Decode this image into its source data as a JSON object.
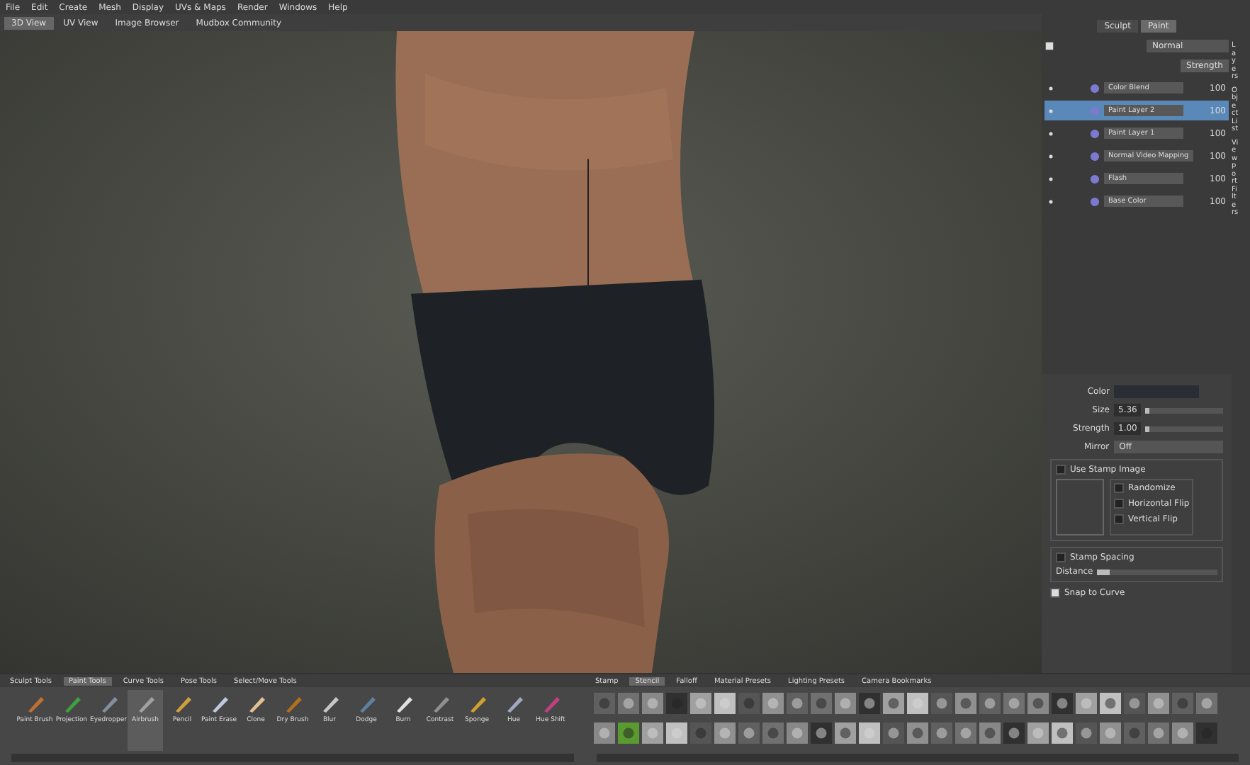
{
  "menu": [
    "File",
    "Edit",
    "Create",
    "Mesh",
    "Display",
    "UVs & Maps",
    "Render",
    "Windows",
    "Help"
  ],
  "view_tabs": [
    {
      "label": "3D View",
      "selected": true
    },
    {
      "label": "UV View",
      "selected": false
    },
    {
      "label": "Image Browser",
      "selected": false
    },
    {
      "label": "Mudbox Community",
      "selected": false
    }
  ],
  "panel": {
    "tabs": [
      {
        "label": "Sculpt",
        "selected": false
      },
      {
        "label": "Paint",
        "selected": true
      }
    ],
    "blend_mode": "Normal",
    "strength_button": "Strength",
    "layers": [
      {
        "name": "Color Blend",
        "value": "100",
        "selected": false
      },
      {
        "name": "Paint Layer 2",
        "value": "100",
        "selected": true
      },
      {
        "name": "Paint Layer 1",
        "value": "100",
        "selected": false
      },
      {
        "name": "Normal Video Mapping",
        "value": "100",
        "selected": false
      },
      {
        "name": "Flash",
        "value": "100",
        "selected": false
      },
      {
        "name": "Base Color",
        "value": "100",
        "selected": false
      }
    ],
    "side_tabs": [
      "Layers",
      "Object List",
      "Viewport Filters"
    ]
  },
  "properties": {
    "color_label": "Color",
    "size_label": "Size",
    "size": "5.36",
    "strength_label": "Strength",
    "strength": "1.00",
    "size_slider": {
      "level": 0.05
    },
    "strength_slider": {
      "level": 0.05
    },
    "distance_slider": {
      "level": 0.1
    },
    "mirror_label": "Mirror",
    "mirror": "Off",
    "use_stamp": {
      "label": "Use Stamp Image",
      "checked": false
    },
    "randomize": {
      "label": "Randomize",
      "checked": false
    },
    "horizontal_flip": {
      "label": "Horizontal Flip",
      "checked": false
    },
    "vertical_flip": {
      "label": "Vertical Flip",
      "checked": false
    },
    "stamp_spacing": {
      "label": "Stamp Spacing",
      "checked": false
    },
    "distance_label": "Distance",
    "snap_to_curve": {
      "label": "Snap to Curve",
      "checked": true
    }
  },
  "tool_tabs": [
    {
      "label": "Sculpt Tools",
      "selected": false
    },
    {
      "label": "Paint Tools",
      "selected": true
    },
    {
      "label": "Curve Tools",
      "selected": false
    },
    {
      "label": "Pose Tools",
      "selected": false
    },
    {
      "label": "Select/Move Tools",
      "selected": false
    }
  ],
  "tools": [
    {
      "label": "Paint Brush",
      "selected": false,
      "color": "#c07030"
    },
    {
      "label": "Projection",
      "selected": false,
      "color": "#40a040"
    },
    {
      "label": "Eyedropper",
      "selected": false,
      "color": "#8090a0"
    },
    {
      "label": "Airbrush",
      "selected": true,
      "color": "#a0a0a0"
    },
    {
      "label": "Pencil",
      "selected": false,
      "color": "#d0a040"
    },
    {
      "label": "Paint Erase",
      "selected": false,
      "color": "#c0c8e0"
    },
    {
      "label": "Clone",
      "selected": false,
      "color": "#e0c090"
    },
    {
      "label": "Dry Brush",
      "selected": false,
      "color": "#b07020"
    },
    {
      "label": "Blur",
      "selected": false,
      "color": "#c8c8c8"
    },
    {
      "label": "Dodge",
      "selected": false,
      "color": "#6080a0"
    },
    {
      "label": "Burn",
      "selected": false,
      "color": "#e0e0e0"
    },
    {
      "label": "Contrast",
      "selected": false,
      "color": "#909090"
    },
    {
      "label": "Sponge",
      "selected": false,
      "color": "#d0a030"
    },
    {
      "label": "Hue",
      "selected": false,
      "color": "#a0a8c0"
    },
    {
      "label": "Hue Shift",
      "selected": false,
      "color": "#c04080"
    }
  ],
  "tray_tabs": [
    {
      "label": "Stamp",
      "selected": false
    },
    {
      "label": "Stencil",
      "selected": true
    },
    {
      "label": "Falloff",
      "selected": false
    },
    {
      "label": "Material Presets",
      "selected": false
    },
    {
      "label": "Lighting Presets",
      "selected": false
    },
    {
      "label": "Camera Bookmarks",
      "selected": false
    }
  ]
}
